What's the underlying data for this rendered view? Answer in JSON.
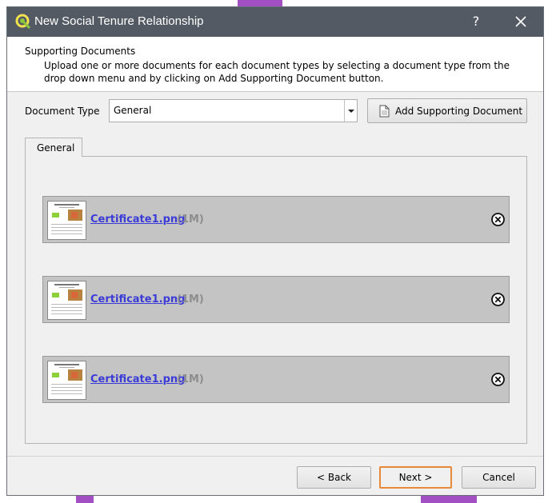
{
  "window": {
    "title": "New Social Tenure Relationship",
    "help_label": "?",
    "app_icon": "qgis-icon"
  },
  "header": {
    "title": "Supporting Documents",
    "description": "Upload one or more documents for each document types by selecting a document type from the drop down menu and by clicking on Add Supporting Document button."
  },
  "form": {
    "document_type_label": "Document Type",
    "document_type_value": "General",
    "add_button_label": "Add Supporting Document"
  },
  "tabs": [
    {
      "label": "General"
    }
  ],
  "documents": [
    {
      "file_name": "Certificate1.png",
      "size": "(1M)"
    },
    {
      "file_name": "Certificate1.png",
      "size": "(1M)"
    },
    {
      "file_name": "Certificate1.png",
      "size": "(1M)"
    }
  ],
  "buttons": {
    "back": "< Back",
    "next": "Next >",
    "cancel": "Cancel"
  },
  "colors": {
    "titlebar": "#545a63",
    "link": "#3b3bd8",
    "focus_outline": "#e68a3a",
    "background_decoration": "#a24fc4"
  }
}
